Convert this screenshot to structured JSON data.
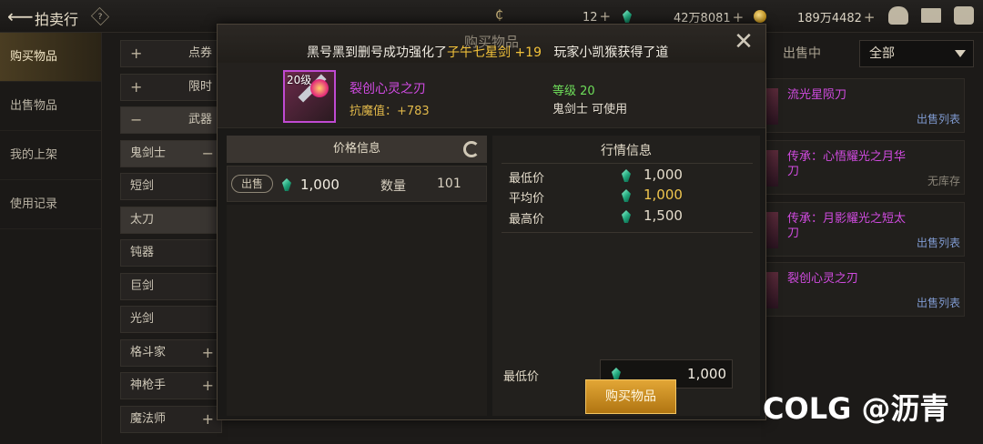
{
  "topbar": {
    "title": "拍卖行",
    "help": "?",
    "currency1_amount": "12",
    "currency2_amount": "42万8081",
    "currency3_amount": "189万4482",
    "plus": "+",
    "icons": [
      "back-arrow-icon",
      "help-icon",
      "coin-c-icon",
      "gem-icon",
      "gold-coin-icon",
      "pot-icon",
      "mail-icon",
      "chat-icon"
    ]
  },
  "leftnav": {
    "items": [
      {
        "label": "购买物品",
        "active": true
      },
      {
        "label": "出售物品",
        "active": false
      },
      {
        "label": "我的上架",
        "active": false
      },
      {
        "label": "使用记录",
        "active": false
      }
    ]
  },
  "categories": {
    "top": [
      {
        "label": "点券",
        "sign": "+"
      },
      {
        "label": "限时",
        "sign": "+"
      },
      {
        "label": "武器",
        "sign": "−"
      }
    ],
    "items": [
      {
        "label": "鬼剑士",
        "sign": "−"
      },
      {
        "label": "短剑",
        "sign": ""
      },
      {
        "label": "太刀",
        "sign": ""
      },
      {
        "label": "钝器",
        "sign": ""
      },
      {
        "label": "巨剑",
        "sign": ""
      },
      {
        "label": "光剑",
        "sign": ""
      },
      {
        "label": "格斗家",
        "sign": "+"
      },
      {
        "label": "神枪手",
        "sign": "+"
      },
      {
        "label": "魔法师",
        "sign": "+"
      }
    ]
  },
  "rightlist": {
    "tab": "出售中",
    "filter": "全部",
    "items": [
      {
        "name": "流光星陨刀",
        "action": "出售列表"
      },
      {
        "name": "传承：心悟耀光之月华刀",
        "action": "无库存"
      },
      {
        "name": "传承：月影耀光之短太刀",
        "action": "出售列表"
      },
      {
        "name": "裂创心灵之刃",
        "action": "出售列表"
      }
    ]
  },
  "modal": {
    "title": "购买物品",
    "broadcast_pre": "黑号黑到删号成功强化了",
    "broadcast_hl": "子午七星剑 +19",
    "broadcast_post": "玩家小凯猴获得了道",
    "close": "✕",
    "item": {
      "level_badge": "20级",
      "name": "裂创心灵之刃",
      "stat": "抗魔值：+783",
      "level": "等级 20",
      "class": "鬼剑士 可使用"
    },
    "price_info": {
      "header": "价格信息",
      "badge": "出售",
      "price": "1,000",
      "qty_label": "数量",
      "qty": "101"
    },
    "market": {
      "title": "行情信息",
      "rows": [
        {
          "label": "最低价",
          "value": "1,000"
        },
        {
          "label": "平均价",
          "value": "1,000"
        },
        {
          "label": "最高价",
          "value": "1,500"
        }
      ],
      "min_label": "最低价",
      "min_value": "1,000"
    },
    "buy_button": "购买物品"
  },
  "watermark": "COLG @沥青",
  "colors": {
    "accent_gold": "#f0c64e",
    "item_purple": "#d24be4",
    "gem_green": "#1fa47a",
    "level_green": "#6ede5a"
  }
}
